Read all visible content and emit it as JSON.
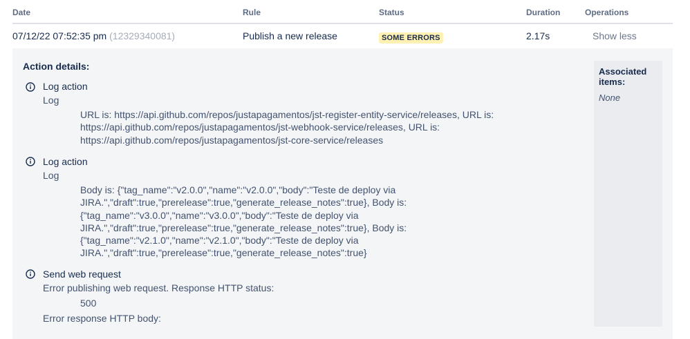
{
  "table": {
    "headers": {
      "date": "Date",
      "rule": "Rule",
      "status": "Status",
      "duration": "Duration",
      "operations": "Operations"
    },
    "row": {
      "date": "07/12/22 07:52:35 pm",
      "id": "(12329340081)",
      "rule": "Publish a new release",
      "status": "SOME ERRORS",
      "duration": "2.17s",
      "operation": "Show less"
    }
  },
  "details": {
    "title": "Action details:",
    "actions": [
      {
        "icon": "info-icon",
        "title": "Log action",
        "subtitle": "Log",
        "lines": [
          "URL is: https://api.github.com/repos/justapagamentos/jst-register-entity-service/releases, URL is:",
          "https://api.github.com/repos/justapagamentos/jst-webhook-service/releases, URL is:",
          "https://api.github.com/repos/justapagamentos/jst-core-service/releases"
        ]
      },
      {
        "icon": "info-icon",
        "title": "Log action",
        "subtitle": "Log",
        "lines": [
          "Body is: {\"tag_name\":\"v2.0.0\",\"name\":\"v2.0.0\",\"body\":\"Teste de deploy via",
          "JIRA.\",\"draft\":true,\"prerelease\":true,\"generate_release_notes\":true}, Body is:",
          "{\"tag_name\":\"v3.0.0\",\"name\":\"v3.0.0\",\"body\":\"Teste de deploy via",
          "JIRA.\",\"draft\":true,\"prerelease\":true,\"generate_release_notes\":true}, Body is:",
          "{\"tag_name\":\"v2.1.0\",\"name\":\"v2.1.0\",\"body\":\"Teste de deploy via",
          "JIRA.\",\"draft\":true,\"prerelease\":true,\"generate_release_notes\":true}"
        ]
      },
      {
        "icon": "info-icon",
        "title": "Send web request",
        "subtitle": "Error publishing web request. Response HTTP status:",
        "lines": [
          "500"
        ],
        "footer": "Error response HTTP body:"
      }
    ],
    "associated": {
      "title": "Associated items:",
      "value": "None"
    }
  },
  "colors": {
    "status_lozenge_bg": "#fff0b3",
    "details_bg": "#f4f5f7",
    "associated_bg": "#ebecf0"
  }
}
